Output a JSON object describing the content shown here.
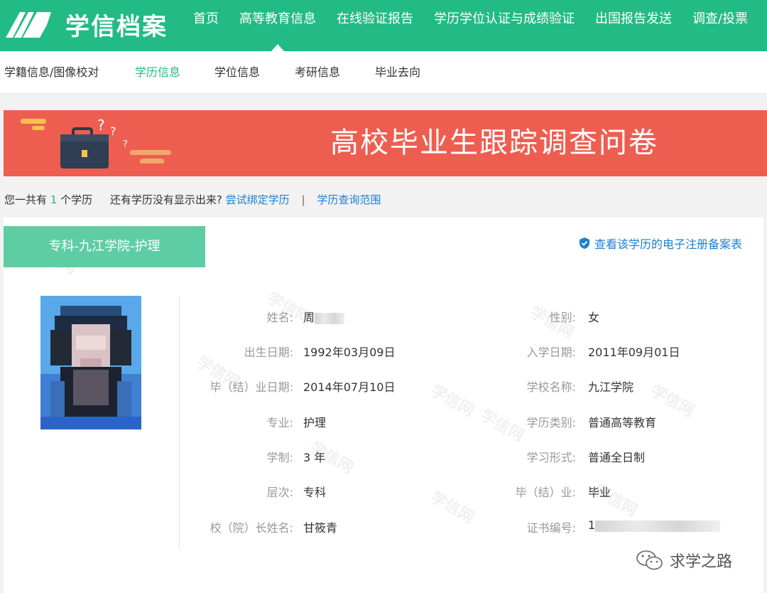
{
  "header": {
    "logo_text": "学信档案",
    "nav": [
      {
        "label": "首页",
        "active": false
      },
      {
        "label": "高等教育信息",
        "active": true
      },
      {
        "label": "在线验证报告",
        "active": false
      },
      {
        "label": "学历学位认证与成绩验证",
        "active": false
      },
      {
        "label": "出国报告发送",
        "active": false
      },
      {
        "label": "调查/投票",
        "active": false
      }
    ]
  },
  "subnav": [
    {
      "label": "学籍信息/图像校对",
      "active": false
    },
    {
      "label": "学历信息",
      "active": true
    },
    {
      "label": "学位信息",
      "active": false
    },
    {
      "label": "考研信息",
      "active": false
    },
    {
      "label": "毕业去向",
      "active": false
    }
  ],
  "banner": {
    "title": "高校毕业生跟踪调查问卷"
  },
  "summary": {
    "prefix": "您一共有",
    "count": "1",
    "suffix": "个学历",
    "question": "还有学历没有显示出来?",
    "bind_link": "尝试绑定学历",
    "separator": "|",
    "range_link": "学历查询范围"
  },
  "record": {
    "tab_label": "专科-九江学院-护理",
    "register_link": "查看该学历的电子注册备案表",
    "watermark": "学信网",
    "fields_left": [
      {
        "label": "姓名:",
        "value": "周"
      },
      {
        "label": "出生日期:",
        "value": "1992年03月09日"
      },
      {
        "label": "毕（结）业日期:",
        "value": "2014年07月10日"
      },
      {
        "label": "专业:",
        "value": "护理"
      },
      {
        "label": "学制:",
        "value": "3 年"
      },
      {
        "label": "层次:",
        "value": "专科"
      },
      {
        "label": "校（院）长姓名:",
        "value": "甘筱青"
      }
    ],
    "fields_right": [
      {
        "label": "性别:",
        "value": "女"
      },
      {
        "label": "入学日期:",
        "value": "2011年09月01日"
      },
      {
        "label": "学校名称:",
        "value": "九江学院"
      },
      {
        "label": "学历类别:",
        "value": "普通高等教育"
      },
      {
        "label": "学习形式:",
        "value": "普通全日制"
      },
      {
        "label": "毕（结）业:",
        "value": "毕业"
      },
      {
        "label": "证书编号:",
        "value": "1"
      }
    ]
  },
  "footer": {
    "wechat_name": "求学之路"
  },
  "colors": {
    "brand": "#22bb85",
    "banner": "#ee5e50",
    "link": "#1e7fd0"
  }
}
